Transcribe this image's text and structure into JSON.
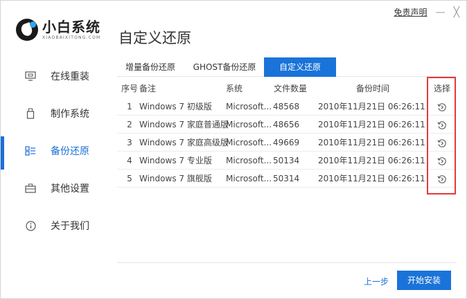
{
  "topbar": {
    "disclaimer": "免责声明",
    "minimize": "—",
    "close": "╳"
  },
  "logo": {
    "name": "小白系统",
    "subtitle": "XIAOBAIXITONG.COM"
  },
  "page_title": "自定义还原",
  "sidebar": {
    "items": [
      {
        "label": "在线重装",
        "icon": "monitor-icon",
        "active": false
      },
      {
        "label": "制作系统",
        "icon": "usb-icon",
        "active": false
      },
      {
        "label": "备份还原",
        "icon": "backup-icon",
        "active": true
      },
      {
        "label": "其他设置",
        "icon": "briefcase-icon",
        "active": false
      },
      {
        "label": "关于我们",
        "icon": "info-icon",
        "active": false
      }
    ]
  },
  "tabs": [
    {
      "label": "增量备份还原",
      "active": false
    },
    {
      "label": "GHOST备份还原",
      "active": false
    },
    {
      "label": "自定义还原",
      "active": true
    }
  ],
  "table": {
    "headers": {
      "index": "序号",
      "note": "备注",
      "system": "系统",
      "file_count": "文件数量",
      "backup_time": "备份时间",
      "select": "选择"
    },
    "rows": [
      {
        "index": "1",
        "note": "Windows 7 初级版",
        "system": "Microsoft...",
        "file_count": "48568",
        "backup_time": "2010年11月21日 06:26:11",
        "action_icon": "restore-icon"
      },
      {
        "index": "2",
        "note": "Windows 7 家庭普通版",
        "system": "Microsoft...",
        "file_count": "48656",
        "backup_time": "2010年11月21日 06:26:11",
        "action_icon": "restore-icon"
      },
      {
        "index": "3",
        "note": "Windows 7 家庭高级版",
        "system": "Microsoft...",
        "file_count": "49669",
        "backup_time": "2010年11月21日 06:26:11",
        "action_icon": "restore-icon"
      },
      {
        "index": "4",
        "note": "Windows 7 专业版",
        "system": "Microsoft...",
        "file_count": "50134",
        "backup_time": "2010年11月21日 06:26:11",
        "action_icon": "restore-icon"
      },
      {
        "index": "5",
        "note": "Windows 7 旗舰版",
        "system": "Microsoft...",
        "file_count": "50314",
        "backup_time": "2010年11月21日 06:26:11",
        "action_icon": "restore-icon"
      }
    ]
  },
  "footer": {
    "prev_label": "上一步",
    "install_label": "开始安装"
  },
  "colors": {
    "accent": "#1a73d9",
    "highlight": "#e53935"
  }
}
